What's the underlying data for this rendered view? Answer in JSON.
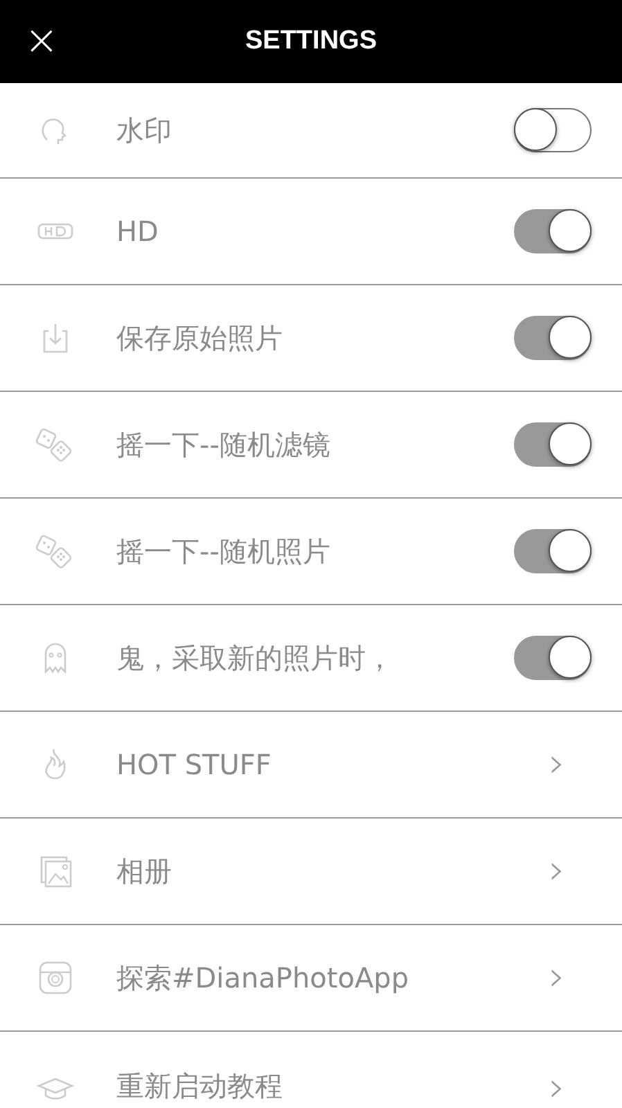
{
  "header": {
    "close": "×",
    "title": "SETTINGS"
  },
  "rows": [
    {
      "kind": "toggle",
      "label": "水印",
      "on": false
    },
    {
      "kind": "toggle",
      "label": "HD",
      "on": true
    },
    {
      "kind": "toggle",
      "label": "保存原始照片",
      "on": true
    },
    {
      "kind": "toggle",
      "label": "摇一下--随机滤镜",
      "on": true
    },
    {
      "kind": "toggle",
      "label": "摇一下--随机照片",
      "on": true
    },
    {
      "kind": "toggle",
      "label": "鬼，采取新的照片时，",
      "on": true
    },
    {
      "kind": "link",
      "label": "HOT STUFF",
      "chevron": "›"
    },
    {
      "kind": "link",
      "label": "相册",
      "chevron": "›"
    },
    {
      "kind": "link",
      "label": "探索#DianaPhotoApp",
      "chevron": "›"
    },
    {
      "kind": "link",
      "label": "重新启动教程",
      "chevron": "›"
    }
  ]
}
